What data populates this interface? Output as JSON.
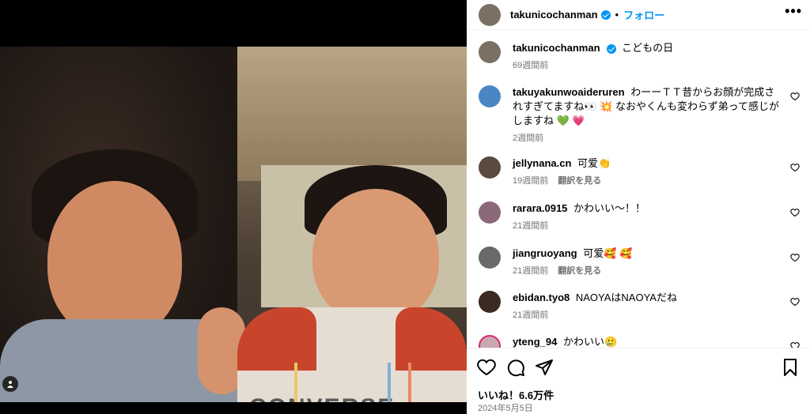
{
  "header": {
    "username": "takunicochanman",
    "separator": "•",
    "follow_label": "フォロー",
    "more_label": "•••"
  },
  "photo": {
    "shirt_text": "CONVERSE"
  },
  "caption": {
    "username": "takunicochanman",
    "text": "こどもの日",
    "time": "69週間前"
  },
  "comments": [
    {
      "username": "takuyakunwoaideruren",
      "text": "わーーＴＴ昔からお顔が完成されすぎてますね👀 💥 なおやくんも変わらず弟って感じがしますね 💚 💗",
      "time": "2週間前",
      "translate": ""
    },
    {
      "username": "jellynana.cn",
      "text": "可爱👏",
      "time": "19週間前",
      "translate": "翻訳を見る"
    },
    {
      "username": "rarara.0915",
      "text": "かわいい〜！！",
      "time": "21週間前",
      "translate": ""
    },
    {
      "username": "jiangruoyang",
      "text": "可爱🥰 🥰",
      "time": "21週間前",
      "translate": "翻訳を見る"
    },
    {
      "username": "ebidan.tyo8",
      "text": "NAOYAはNAOYAだね",
      "time": "21週間前",
      "translate": ""
    },
    {
      "username": "yteng_94",
      "text": "かわいい🥲",
      "time": "",
      "translate": ""
    }
  ],
  "footer": {
    "likes": "いいね！6.6万件",
    "date": "2024年5月5日"
  },
  "icons": {
    "like": "heart-icon",
    "comment": "comment-icon",
    "share": "share-icon",
    "save": "bookmark-icon",
    "user_tag": "user-tag-icon"
  },
  "colors": {
    "accent": "#0095f6",
    "muted": "#737373",
    "border": "#efefef"
  }
}
